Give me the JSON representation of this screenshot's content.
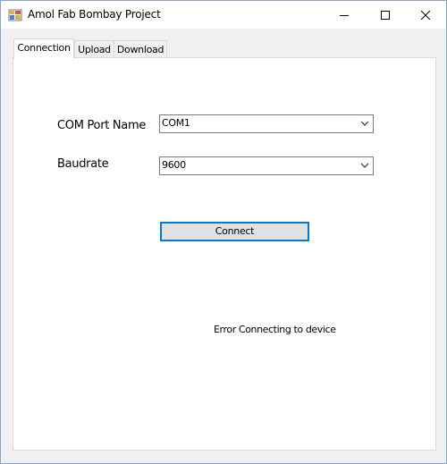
{
  "window": {
    "title": "Amol Fab Bombay Project",
    "app_icon": "window-app-icon",
    "controls": {
      "minimize_icon": "minimize-icon",
      "maximize_icon": "maximize-icon",
      "close_icon": "close-icon"
    }
  },
  "tabs": [
    {
      "label": "Connection",
      "active": true
    },
    {
      "label": "Upload",
      "active": false
    },
    {
      "label": "Download",
      "active": false
    }
  ],
  "connection": {
    "com_port": {
      "label": "COM Port Name",
      "value": "COM1"
    },
    "baudrate": {
      "label": "Baudrate",
      "value": "9600"
    },
    "connect_label": "Connect",
    "status_text": "Error Connecting to device"
  },
  "colors": {
    "focus_border": "#0078d7",
    "tab_border": "#d9d9d9",
    "window_border": "#8aa2c4"
  }
}
